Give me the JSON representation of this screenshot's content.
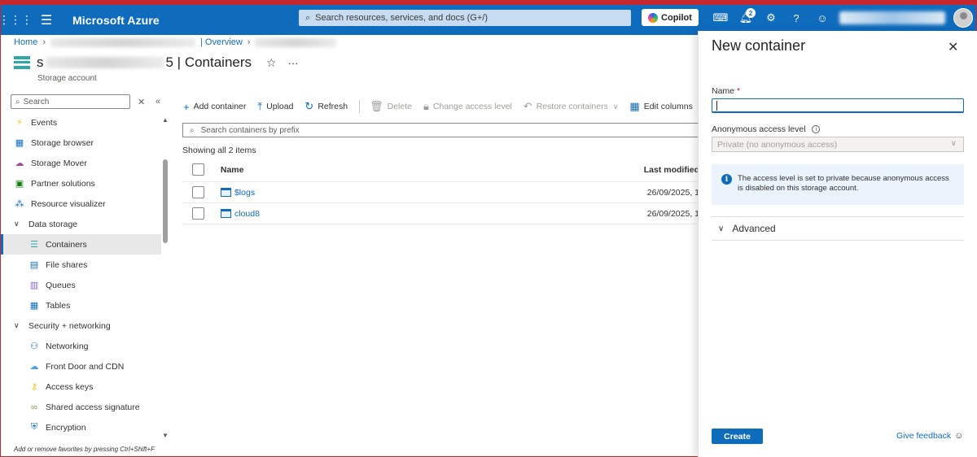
{
  "topbar": {
    "brand": "Microsoft Azure",
    "search_placeholder": "Search resources, services, and docs (G+/)",
    "copilot_label": "Copilot",
    "notification_count": "2"
  },
  "breadcrumb": {
    "home": "Home",
    "overview": "| Overview"
  },
  "resource": {
    "title_prefix": "s",
    "title_suffix": "5 | Containers",
    "subtitle": "Storage account"
  },
  "nav": {
    "search_placeholder": "Search",
    "items": [
      {
        "label": "Events",
        "icon": "lightning-icon"
      },
      {
        "label": "Storage browser",
        "icon": "storage-browser-icon"
      },
      {
        "label": "Storage Mover",
        "icon": "storage-mover-icon"
      },
      {
        "label": "Partner solutions",
        "icon": "partner-icon"
      },
      {
        "label": "Resource visualizer",
        "icon": "visualizer-icon"
      }
    ],
    "group_data_storage": "Data storage",
    "data_storage": [
      {
        "label": "Containers",
        "icon": "containers-icon"
      },
      {
        "label": "File shares",
        "icon": "file-shares-icon"
      },
      {
        "label": "Queues",
        "icon": "queues-icon"
      },
      {
        "label": "Tables",
        "icon": "tables-icon"
      }
    ],
    "group_security": "Security + networking",
    "security": [
      {
        "label": "Networking",
        "icon": "networking-icon"
      },
      {
        "label": "Front Door and CDN",
        "icon": "cdn-icon"
      },
      {
        "label": "Access keys",
        "icon": "key-icon"
      },
      {
        "label": "Shared access signature",
        "icon": "link-icon"
      },
      {
        "label": "Encryption",
        "icon": "shield-icon"
      }
    ],
    "footer": "Add or remove favorites by pressing Ctrl+Shift+F"
  },
  "toolbar": {
    "add_container": "Add container",
    "upload": "Upload",
    "refresh": "Refresh",
    "delete": "Delete",
    "change_access": "Change access level",
    "restore": "Restore containers",
    "edit_columns": "Edit columns"
  },
  "list": {
    "filter_placeholder": "Search containers by prefix",
    "count": "Showing all 2 items",
    "col_name": "Name",
    "col_modified": "Last modified",
    "rows": [
      {
        "name": "$logs",
        "modified": "26/09/2025, 1"
      },
      {
        "name": "cloud8",
        "modified": "26/09/2025, 1"
      }
    ]
  },
  "panel": {
    "title": "New container",
    "name_label": "Name",
    "required_mark": "*",
    "access_label": "Anonymous access level",
    "access_value": "Private (no anonymous access)",
    "info_text": "The access level is set to private because anonymous access is disabled on this storage account.",
    "advanced": "Advanced",
    "create": "Create",
    "feedback": "Give feedback"
  },
  "colors": {
    "azure_blue": "#0f6cbd",
    "frame_red": "#c4262e"
  }
}
